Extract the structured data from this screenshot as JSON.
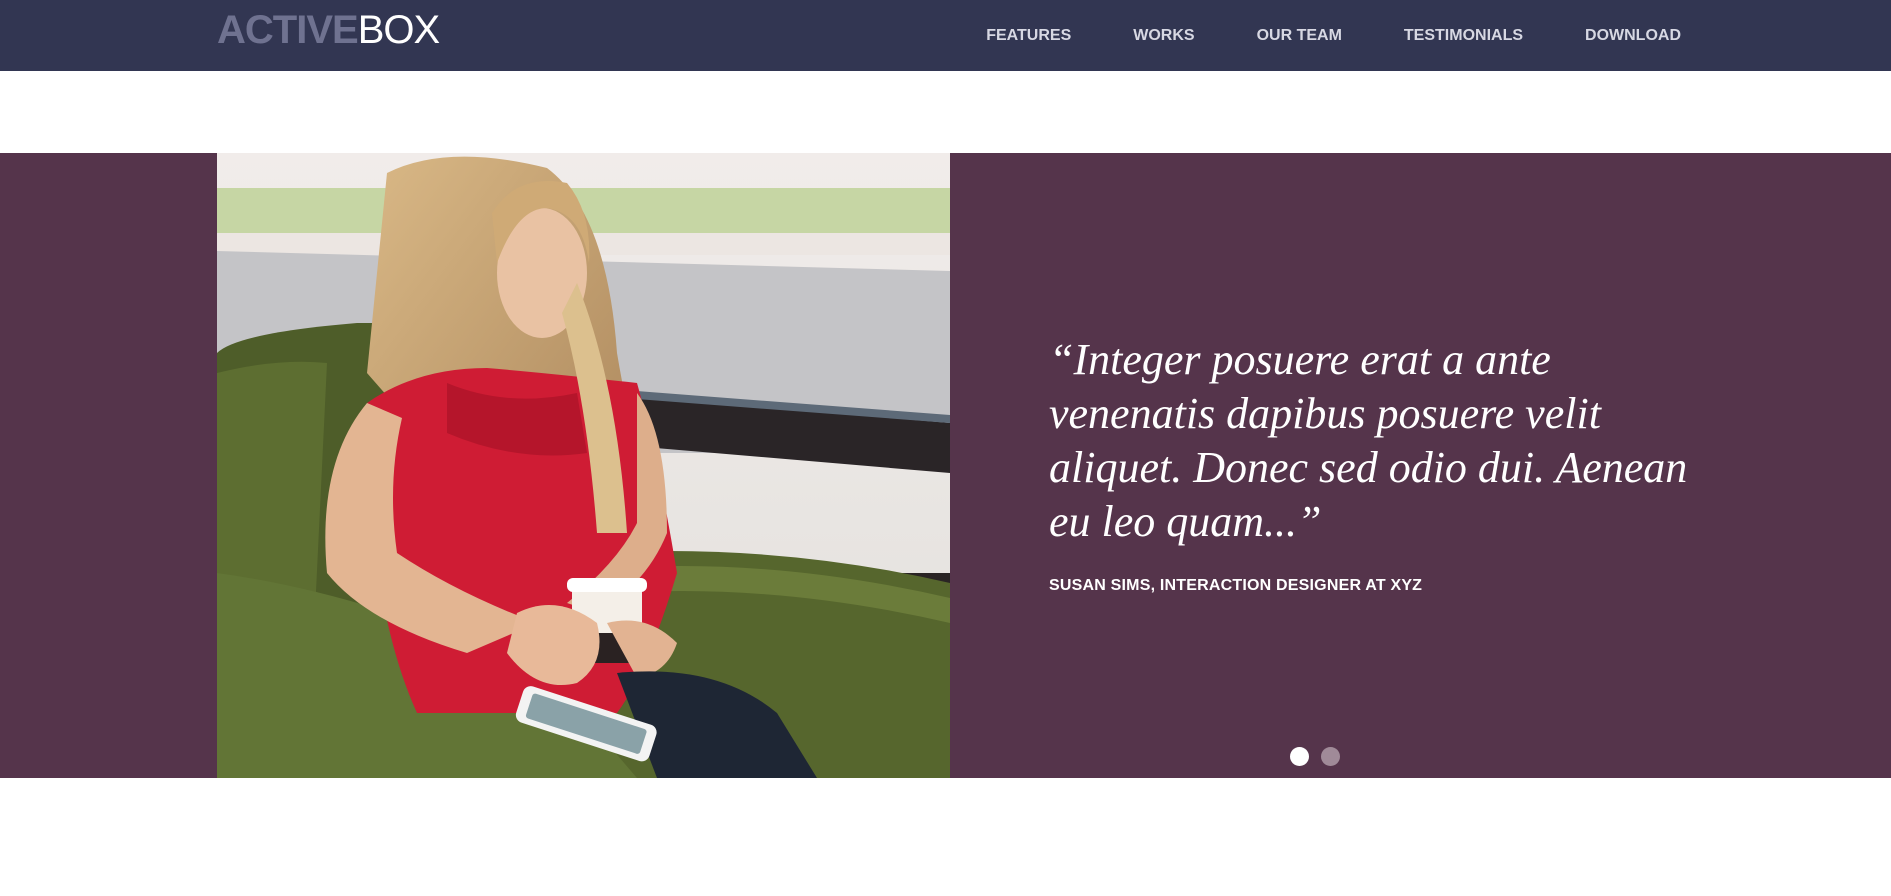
{
  "brand": {
    "logo_part_1": "ACTIVE",
    "logo_part_2": "BOX"
  },
  "nav": {
    "items": [
      {
        "label": "FEATURES"
      },
      {
        "label": "WORKS"
      },
      {
        "label": "OUR TEAM"
      },
      {
        "label": "TESTIMONIALS"
      },
      {
        "label": "DOWNLOAD"
      }
    ]
  },
  "testimonial": {
    "quote": "“Integer posuere erat a ante venenatis dapibus posuere velit aliquet. Donec sed odio dui. Aenean eu leo quam...”",
    "author": "SUSAN SIMS, INTERACTION DESIGNER AT XYZ",
    "slides": 2,
    "active_slide": 1
  },
  "colors": {
    "navbar_bg": "#323652",
    "section_bg": "#55344b",
    "logo_dim": "#6f7290",
    "dot_active": "#ffffff",
    "dot_inactive": "#a08a98"
  }
}
